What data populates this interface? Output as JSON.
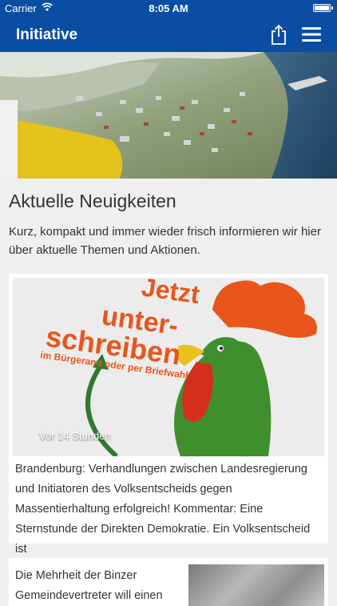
{
  "status_bar": {
    "carrier": "Carrier",
    "time": "8:05 AM"
  },
  "nav": {
    "title": "Initiative",
    "icons": [
      "share-icon",
      "menu-icon"
    ]
  },
  "hero": {
    "icon": "aerial-photo"
  },
  "section": {
    "heading": "Aktuelle Neuigkeiten",
    "intro": "Kurz, kompakt und immer wieder frisch informieren wir hier über aktuelle Themen und Aktionen."
  },
  "news": [
    {
      "time": "Vor 14 Stunden",
      "image_text": {
        "line1": "Jetzt",
        "line2": "unter-",
        "line3": "schreiben",
        "line4": "im Bürgeramt oder per Briefwahl"
      },
      "text": "Brandenburg: Verhandlungen zwischen Landesregierung und Initiatoren des Volksentscheids gegen Massentierhaltung erfolgreich! Kommentar: Eine Sternstunde der Direkten Demokratie. Ein Volksentscheid ist"
    },
    {
      "text": "Die Mehrheit der Binzer Gemeindevertreter will einen"
    }
  ],
  "colors": {
    "primary": "#0a4ea3",
    "background": "#efefef",
    "accent_orange": "#e8561b"
  }
}
